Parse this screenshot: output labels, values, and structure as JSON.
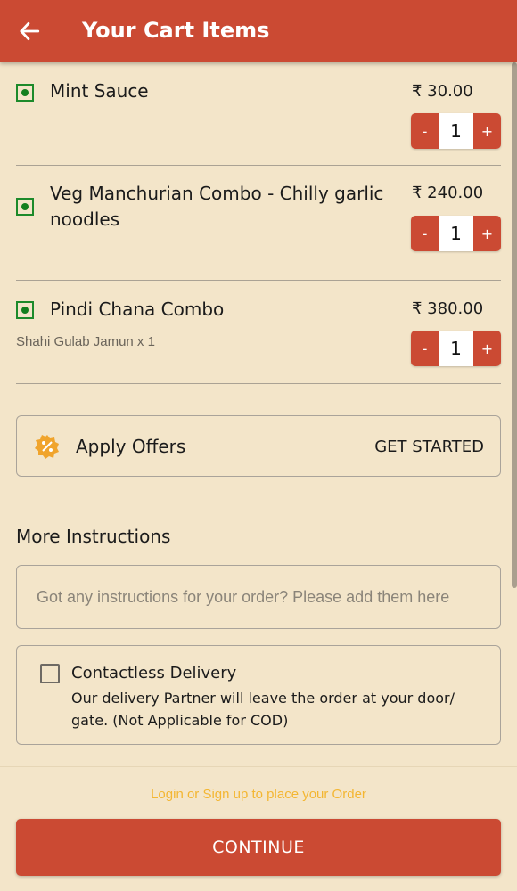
{
  "header": {
    "title": "Your Cart Items",
    "back_icon": "arrow-left-icon"
  },
  "cart": {
    "items": [
      {
        "name": "Mint Sauce",
        "price": "₹ 30.00",
        "quantity": "1",
        "addon": "",
        "veg": true
      },
      {
        "name": "Veg Manchurian Combo  - Chilly garlic noodles",
        "price": "₹ 240.00",
        "quantity": "1",
        "addon": "",
        "veg": true
      },
      {
        "name": "Pindi Chana Combo",
        "price": "₹ 380.00",
        "quantity": "1",
        "addon": "Shahi Gulab Jamun x 1",
        "veg": true
      }
    ],
    "decrement_label": "-",
    "increment_label": "+"
  },
  "offers": {
    "label": "Apply Offers",
    "action": "GET STARTED",
    "icon": "discount-badge-icon"
  },
  "instructions": {
    "title": "More Instructions",
    "placeholder": "Got any instructions for your order? Please add them here",
    "value": ""
  },
  "contactless": {
    "title": "Contactless Delivery",
    "description": "Our delivery Partner will leave the order at your door/ gate. (Not Applicable for COD)",
    "checked": false
  },
  "footer": {
    "login_prompt": "Login or Sign up to place your Order",
    "continue_label": "CONTINUE"
  },
  "colors": {
    "primary": "#cb4a33",
    "background": "#f3e5c9",
    "veg_green": "#137f1e",
    "offer_orange": "#f0a42c",
    "login_link": "#f3b632"
  }
}
